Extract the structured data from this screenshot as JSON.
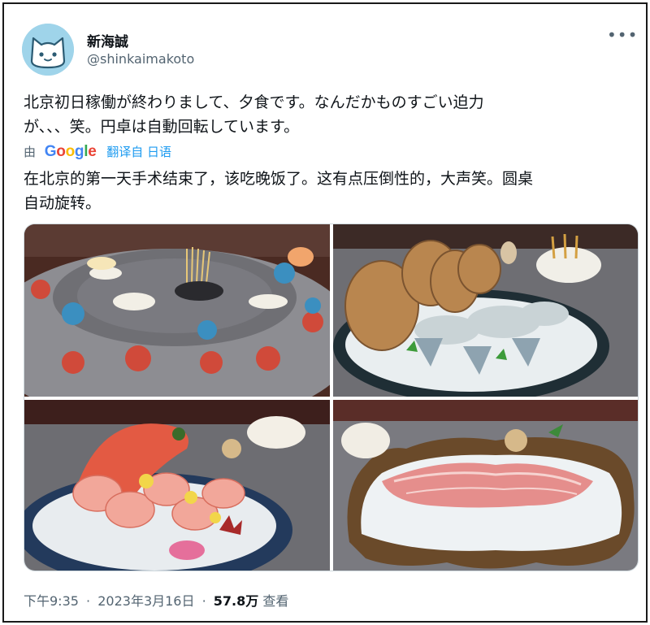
{
  "author": {
    "name": "新海誠",
    "handle": "@shinkaimakoto",
    "avatar_icon": "cat-avatar-icon"
  },
  "more_icon": "more-horizontal-icon",
  "tweet": {
    "text": "北京初日稼働が終わりまして、夕食です。なんだかものすごい迫力\nが、、、笑。円卓は自動回転しています。"
  },
  "translation": {
    "by_label": "由",
    "provider_logo": "Google",
    "link_label": "翻译自 日语",
    "translated_text": "在北京的第一天手术结束了，该吃晚饭了。这有点压倒性的，大声笑。圆桌\n自动旋转。"
  },
  "media": {
    "photos": [
      {
        "subject": "round-table-dinner-photo"
      },
      {
        "subject": "clams-on-ice-photo"
      },
      {
        "subject": "fish-sashimi-photo"
      },
      {
        "subject": "wagyu-beef-photo"
      }
    ]
  },
  "meta": {
    "time": "下午9:35",
    "separator": "·",
    "date": "2023年3月16日",
    "views_count": "57.8万",
    "views_label": "查看"
  },
  "colors": {
    "text_primary": "#0f1419",
    "text_secondary": "#536471",
    "link": "#1d9bf0",
    "avatar_bg": "#9fd4ea",
    "google_blue": "#4285f4",
    "google_red": "#ea4335",
    "google_yellow": "#fbbc05",
    "google_green": "#34a853"
  }
}
